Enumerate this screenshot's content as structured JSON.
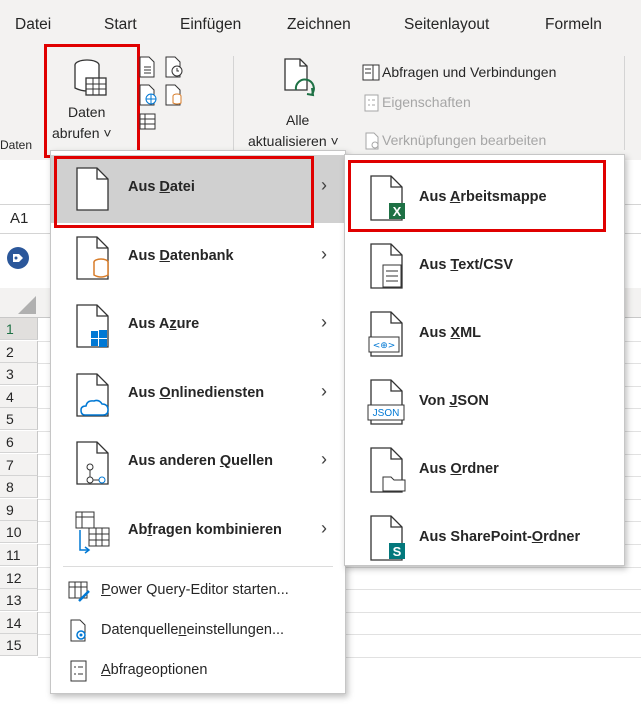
{
  "tabs": [
    "Datei",
    "Start",
    "Einfügen",
    "Zeichnen",
    "Seitenlayout",
    "Formeln"
  ],
  "ribbon": {
    "daten_abrufen_line1": "Daten",
    "daten_abrufen_line2": "abrufen ˅",
    "alle_line1": "Alle",
    "alle_line2": "aktualisieren ˅",
    "abfragen_verbindungen": "Abfragen und Verbindungen",
    "eigenschaften": "Eigenschaften",
    "verknuepfungen": "Verknüpfungen bearbeiten",
    "group_label": "Daten"
  },
  "namebox": "A1",
  "rows": [
    "1",
    "2",
    "3",
    "4",
    "5",
    "6",
    "7",
    "8",
    "9",
    "10",
    "11",
    "12",
    "13",
    "14",
    "15"
  ],
  "menu": {
    "items": [
      {
        "pre": "Aus ",
        "acc": "D",
        "post": "atei",
        "icon": "file-icon",
        "active": true
      },
      {
        "pre": "Aus ",
        "acc": "D",
        "post": "atenbank",
        "icon": "database-icon"
      },
      {
        "pre": "Aus A",
        "acc": "z",
        "post": "ure",
        "icon": "azure-icon"
      },
      {
        "pre": "Aus ",
        "acc": "O",
        "post": "nlinediensten",
        "icon": "cloud-icon"
      },
      {
        "pre": "Aus anderen ",
        "acc": "Q",
        "post": "uellen",
        "icon": "network-icon"
      },
      {
        "pre": "Ab",
        "acc": "f",
        "post": "ragen kombinieren",
        "icon": "combine-icon"
      }
    ],
    "small_items": [
      {
        "pre": "",
        "acc": "P",
        "post": "ower Query-Editor starten...",
        "icon": "power-query-icon"
      },
      {
        "pre": "Datenquelle",
        "acc": "n",
        "post": "einstellungen...",
        "icon": "datasource-settings-icon"
      },
      {
        "pre": "",
        "acc": "A",
        "post": "bfrageoptionen",
        "icon": "query-options-icon"
      }
    ]
  },
  "submenu": {
    "items": [
      {
        "pre": "Aus ",
        "acc": "A",
        "post": "rbeitsmappe",
        "icon": "excel-workbook-icon"
      },
      {
        "pre": "Aus ",
        "acc": "T",
        "post": "ext/CSV",
        "icon": "text-csv-icon"
      },
      {
        "pre": "Aus ",
        "acc": "X",
        "post": "ML",
        "icon": "xml-icon"
      },
      {
        "pre": "Von ",
        "acc": "J",
        "post": "SON",
        "icon": "json-icon"
      },
      {
        "pre": "Aus ",
        "acc": "O",
        "post": "rdner",
        "icon": "folder-icon"
      },
      {
        "pre": "Aus SharePoint-",
        "acc": "O",
        "post": "rdner",
        "icon": "sharepoint-folder-icon"
      }
    ],
    "xml_badge": "<⊕>",
    "json_badge": "JSON",
    "excel_letter": "X",
    "sharepoint_letter": "S"
  },
  "colors": {
    "highlight": "#e00000",
    "excel_green": "#1e7145",
    "sharepoint_teal": "#03787c",
    "azure_blue": "#0078d4",
    "database_orange": "#d87d2a",
    "ribbon_bg": "#f3f2f1"
  }
}
